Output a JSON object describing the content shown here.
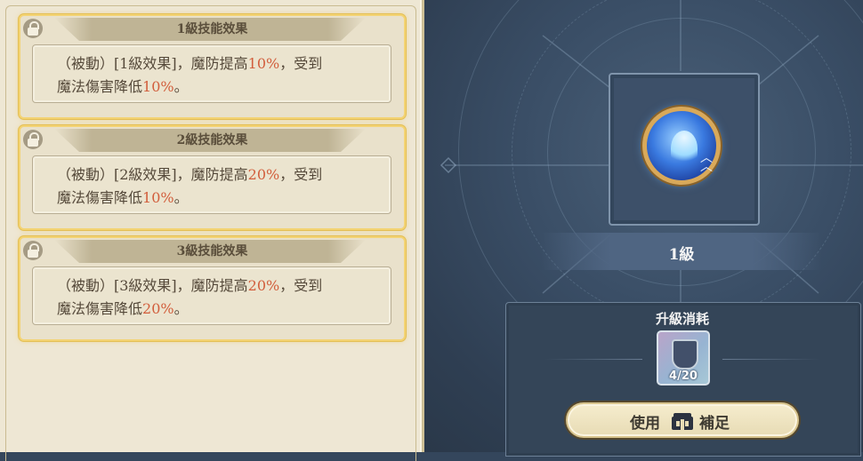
{
  "skill_levels": [
    {
      "title": "1級技能效果",
      "locked": true,
      "line1": [
        "（被動）[1級效果]，魔防提高",
        "10%",
        "，受到"
      ],
      "line2": [
        "魔法傷害降低",
        "10%",
        "。"
      ]
    },
    {
      "title": "2級技能效果",
      "locked": true,
      "line1": [
        "（被動）[2級效果]，魔防提高",
        "20%",
        "，受到"
      ],
      "line2": [
        "魔法傷害降低",
        "10%",
        "。"
      ]
    },
    {
      "title": "3級技能效果",
      "locked": true,
      "line1": [
        "（被動）[3級效果]，魔防提高",
        "20%",
        "，受到"
      ],
      "line2": [
        "魔法傷害降低",
        "20%",
        "。"
      ]
    }
  ],
  "skill": {
    "icon": "blue-figure-skill-icon",
    "level_label": "1級"
  },
  "upgrade": {
    "title": "升級消耗",
    "item_icon": "shield-token-icon",
    "item_count": "4/20",
    "button_left": "使用",
    "button_icon": "gift-box-icon",
    "button_right": "補足"
  },
  "colors": {
    "highlight": "#d25e3c",
    "card_border": "#f3d374",
    "panel_dark": "#344558"
  }
}
